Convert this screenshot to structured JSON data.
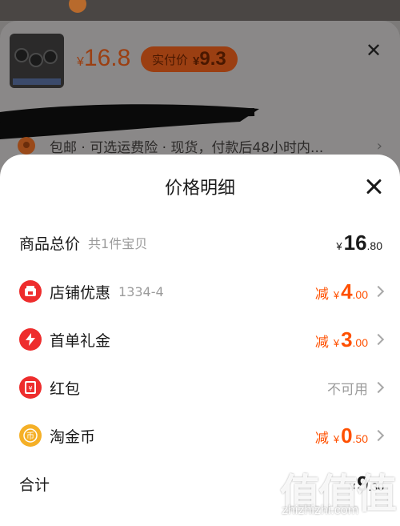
{
  "background": {
    "price": {
      "currency": "¥",
      "value": "16.8"
    },
    "paid_pill": {
      "label": "实付价",
      "currency": "¥",
      "value": "9.3"
    },
    "shipping_text": "包邮 · 可选运费险 · 现货，付款后48小时内..."
  },
  "sheet": {
    "title": "价格明细",
    "rows": [
      {
        "label": "商品总价",
        "sub": "共1件宝贝",
        "currency": "¥",
        "int": "16",
        "dec": ".80"
      },
      {
        "label": "店铺优惠",
        "sub": "1334-4",
        "prefix": "减",
        "currency": "¥",
        "int": "4",
        "dec": ".00",
        "icon": "shop-icon"
      },
      {
        "label": "首单礼金",
        "prefix": "减",
        "currency": "¥",
        "int": "3",
        "dec": ".00",
        "icon": "lightning-icon"
      },
      {
        "label": "红包",
        "status": "不可用",
        "icon": "red-packet-icon"
      },
      {
        "label": "淘金币",
        "prefix": "减",
        "currency": "¥",
        "int": "0",
        "dec": ".50",
        "icon": "coin-icon"
      }
    ],
    "total": {
      "label": "合计",
      "currency": "¥",
      "int": "9",
      "dec": ".30"
    }
  },
  "watermark": {
    "text": "值值值",
    "url": "zhizhizhi.com"
  },
  "colors": {
    "accent": "#ff5000",
    "red_icon": "#ee2d2d",
    "coin": "#f5b027"
  }
}
